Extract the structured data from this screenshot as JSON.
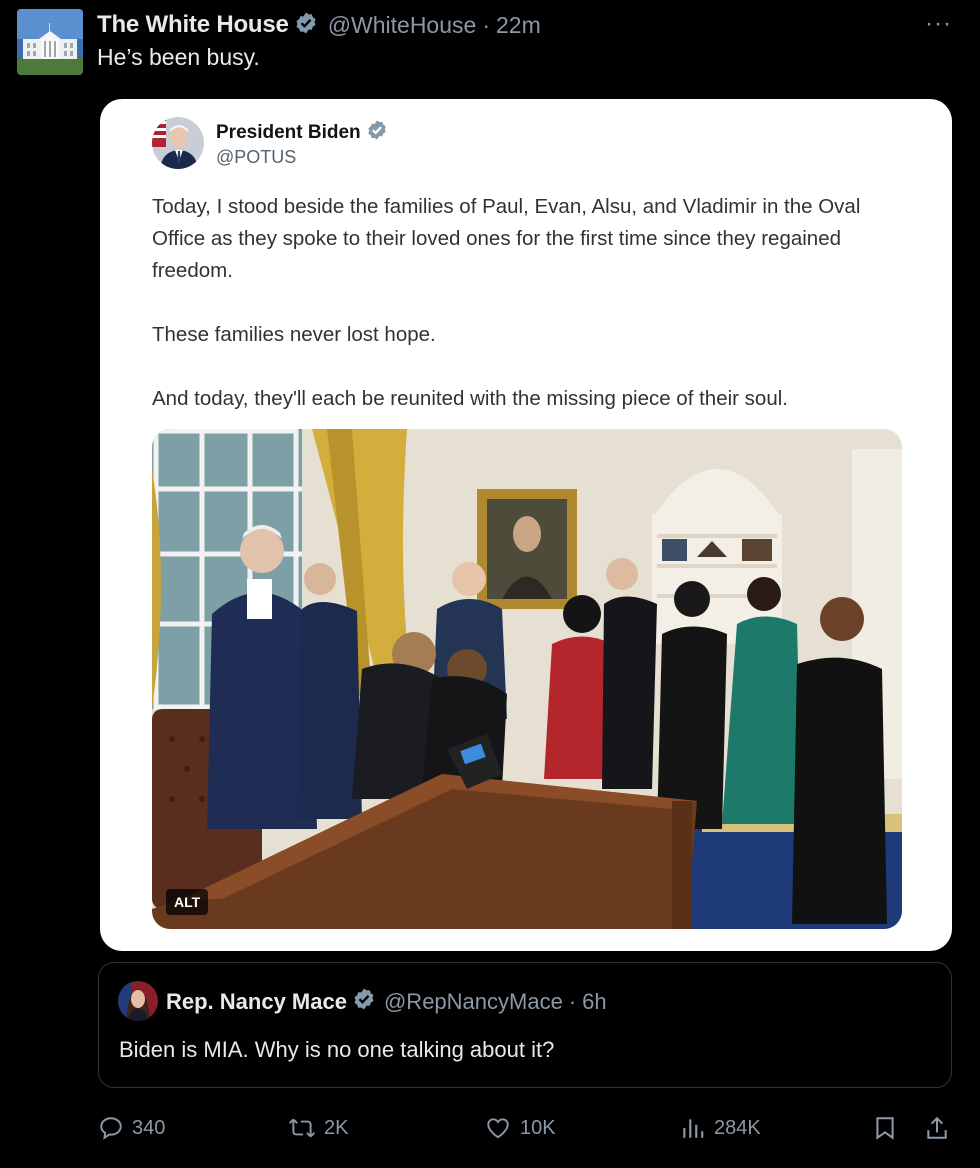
{
  "tweet": {
    "author_name": "The White House",
    "author_handle": "@WhiteHouse",
    "separator": "·",
    "time": "22m",
    "more": "···",
    "text": "He’s been busy."
  },
  "quoted": {
    "author_name": "President Biden",
    "author_handle": "@POTUS",
    "paragraphs": [
      "Today, I stood beside the families of Paul, Evan, Alsu, and Vladimir in the Oval Office as they spoke to their loved ones for the first time since they regained freedom.",
      "These families never lost hope.",
      "And today, they'll each be reunited with the missing piece of their soul."
    ],
    "photo_alt_badge": "ALT"
  },
  "nested_quote": {
    "author_name": "Rep. Nancy Mace",
    "author_handle": "@RepNancyMace",
    "separator": "·",
    "time": "6h",
    "text": "Biden is MIA. Why is no one talking about it?"
  },
  "actions": {
    "replies": "340",
    "reposts": "2K",
    "likes": "10K",
    "views": "284K"
  },
  "colors": {
    "verified_blue": "#1d9bf0",
    "verified_gray": "#829aab",
    "muted_text": "#8b98a5"
  }
}
